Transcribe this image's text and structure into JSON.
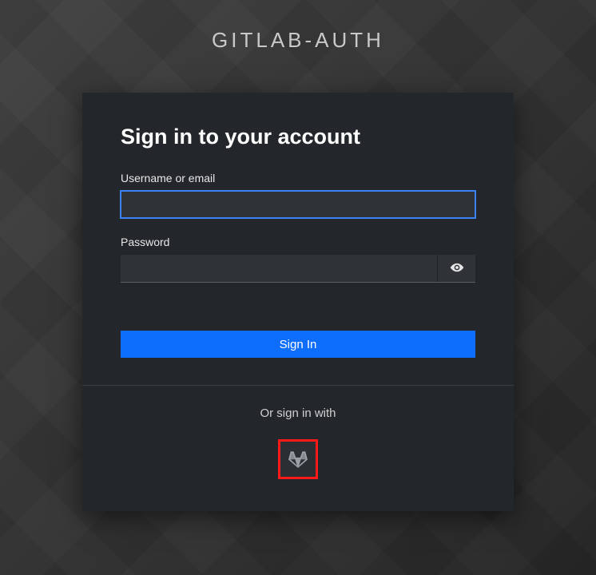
{
  "app": {
    "title": "GITLAB-AUTH"
  },
  "login": {
    "heading": "Sign in to your account",
    "username_label": "Username or email",
    "username_value": "",
    "password_label": "Password",
    "password_value": "",
    "submit_label": "Sign In",
    "alt_label": "Or sign in with",
    "provider_icon": "gitlab-icon"
  },
  "colors": {
    "accent": "#0d6efd",
    "highlight_border": "#ff1a1a",
    "focus": "#3b82f6"
  }
}
